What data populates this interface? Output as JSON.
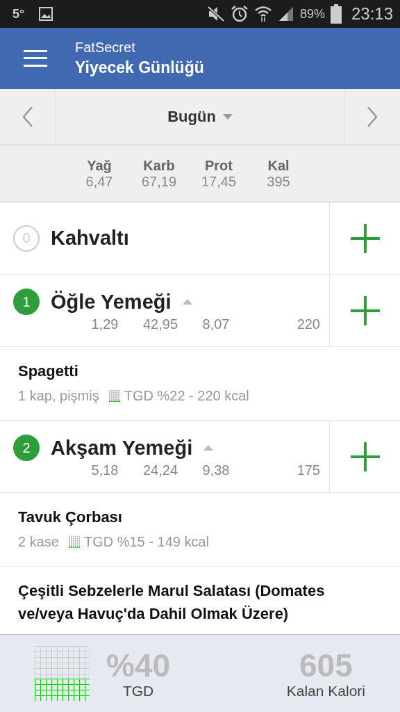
{
  "status_bar": {
    "temperature": "5°",
    "battery": "89%",
    "time": "23:13"
  },
  "app_bar": {
    "app_name": "FatSecret",
    "title": "Yiyecek Günlüğü"
  },
  "date_nav": {
    "label": "Bugün"
  },
  "totals": [
    {
      "label": "Yağ",
      "value": "6,47"
    },
    {
      "label": "Karb",
      "value": "67,19"
    },
    {
      "label": "Prot",
      "value": "17,45"
    },
    {
      "label": "Kal",
      "value": "395"
    }
  ],
  "meals": [
    {
      "count": "0",
      "active": false,
      "name": "Kahvaltı"
    },
    {
      "count": "1",
      "active": true,
      "name": "Öğle Yemeği",
      "values": [
        "1,29",
        "42,95",
        "8,07",
        "220"
      ],
      "foods": [
        {
          "name": "Spagetti",
          "portion": "1  kap, pişmiş",
          "info": "TGD %22 - 220 kcal"
        }
      ]
    },
    {
      "count": "2",
      "active": true,
      "name": "Akşam Yemeği",
      "values": [
        "5,18",
        "24,24",
        "9,38",
        "175"
      ],
      "foods": [
        {
          "name": "Tavuk Çorbası",
          "portion": "2  kase",
          "info": "TGD %15 - 149 kcal"
        },
        {
          "name": "Çeşitli Sebzelerle Marul Salatası (Domates ve/veya Havuç'da Dahil Olmak Üzere)"
        }
      ]
    }
  ],
  "summary": {
    "percent": "%40",
    "percent_label": "TGD",
    "calories": "605",
    "calories_label": "Kalan Kalori"
  }
}
